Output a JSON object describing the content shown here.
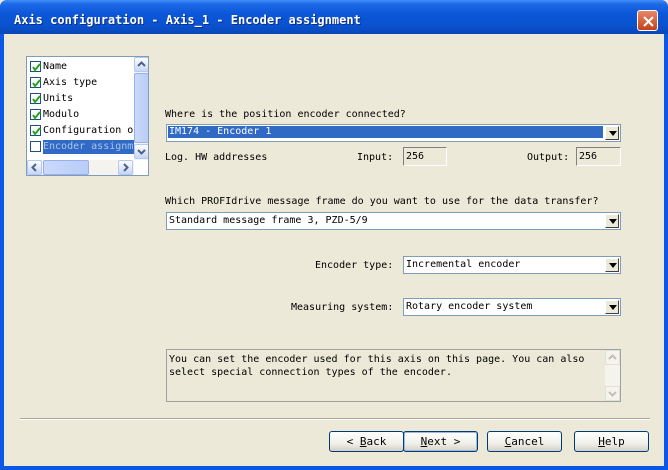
{
  "window": {
    "title": "Axis configuration - Axis_1 - Encoder assignment",
    "close_icon": "close-icon"
  },
  "tree": {
    "items": [
      {
        "label": "Name",
        "checked": true
      },
      {
        "label": "Axis type",
        "checked": true
      },
      {
        "label": "Units",
        "checked": true
      },
      {
        "label": "Modulo",
        "checked": true
      },
      {
        "label": "Configuration o",
        "checked": true
      },
      {
        "label": "Encoder assignm",
        "checked": false,
        "selected": true
      }
    ]
  },
  "encoder_connection": {
    "question": "Where is the position encoder connected?",
    "selected": "IM174 - Encoder 1"
  },
  "hw_addresses": {
    "label": "Log. HW addresses",
    "input_label": "Input:",
    "input_value": "256",
    "output_label": "Output:",
    "output_value": "256"
  },
  "profidrive": {
    "question": "Which PROFIdrive message frame do you want to use for the data transfer?",
    "selected": "Standard message frame 3, PZD-5/9"
  },
  "encoder_type": {
    "label": "Encoder type:",
    "selected": "Incremental encoder"
  },
  "measuring_system": {
    "label": "Measuring system:",
    "selected": "Rotary encoder system"
  },
  "info_text": "You can set the encoder used for this axis on this page. You can also\nselect special connection types of the encoder.",
  "buttons": {
    "back_prefix": "< ",
    "back_key": "B",
    "back_rest": "ack",
    "next_key": "N",
    "next_rest": "ext >",
    "cancel_key": "C",
    "cancel_rest": "ancel",
    "help_key": "H",
    "help_rest": "elp"
  }
}
